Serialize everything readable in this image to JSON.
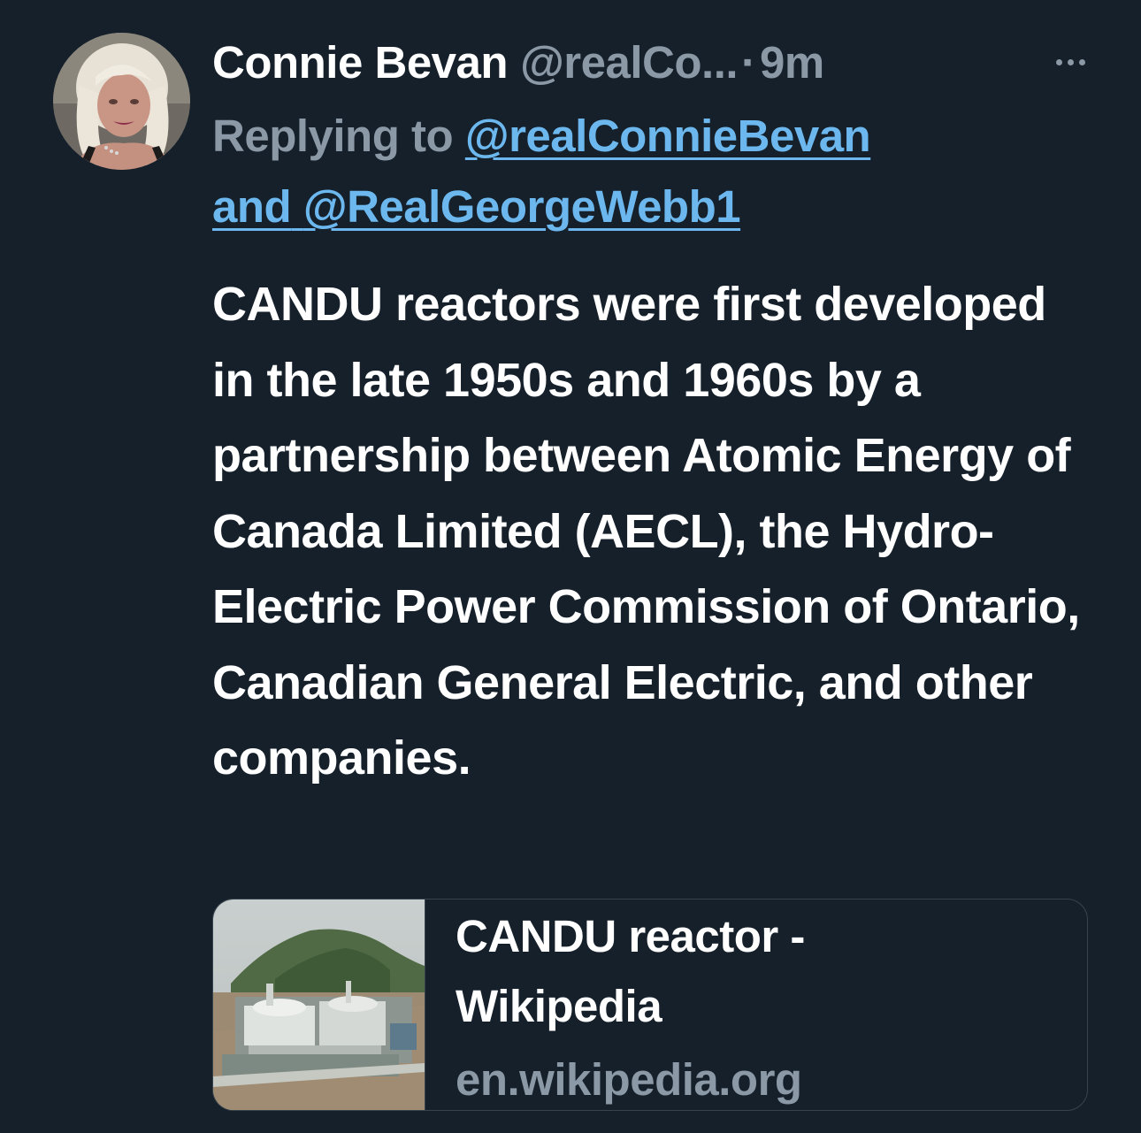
{
  "author": {
    "display_name": "Connie Bevan",
    "handle": "@realCo...",
    "separator": "·",
    "time": "9m"
  },
  "reply": {
    "prefix": "Replying to",
    "mention_1": "@realConnieBevan",
    "joiner": "and",
    "mention_2": "@RealGeorgeWebb1"
  },
  "tweet": {
    "text": "CANDU reactors were first developed in the late 1950s and 1960s by a partnership between Atomic Energy of Canada Limited (AECL), the Hydro-Electric Power Commission of Ontario, Canadian General Electric, and other companies."
  },
  "link_card": {
    "title": "CANDU reactor - Wikipedia",
    "domain": "en.wikipedia.org",
    "thumbnail_icon": "nuclear-plant-photo"
  },
  "icons": {
    "more": "more-options-icon",
    "avatar": "avatar-photo"
  },
  "colors": {
    "background": "#15202b",
    "text_primary": "#ffffff",
    "text_secondary": "#8b98a5",
    "link": "#6cb8ee",
    "border": "#38444d"
  }
}
